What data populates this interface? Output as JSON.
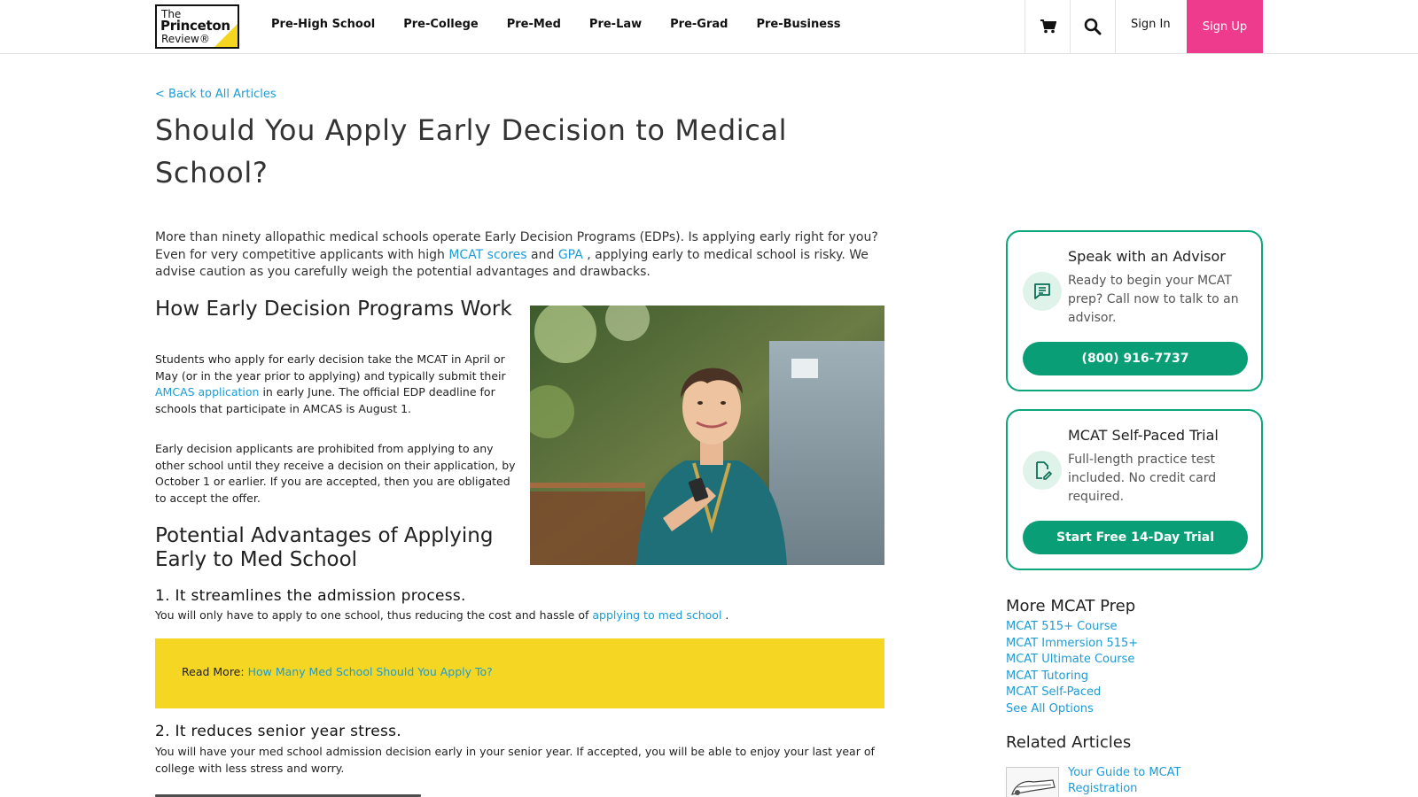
{
  "header": {
    "logo": {
      "line1": "The",
      "line2": "Princeton",
      "line3": "Review®"
    },
    "nav": [
      "Pre-High School",
      "Pre-College",
      "Pre-Med",
      "Pre-Law",
      "Pre-Grad",
      "Pre-Business"
    ],
    "cart_icon": "shopping-cart-icon",
    "search_icon": "search-icon",
    "sign_in": "Sign In",
    "sign_up": "Sign Up"
  },
  "article": {
    "back_link": "< Back to All Articles",
    "title": "Should You Apply Early Decision to Medical School?",
    "intro": {
      "t1": "More than ninety allopathic medical schools operate Early Decision Programs (EDPs). Is applying early right for you? Even for very competitive applicants with high ",
      "link1": "MCAT scores",
      "t2": " and ",
      "link2": "GPA",
      "t3": " , applying early to medical school is risky. We advise caution as you carefully weigh the potential advantages and drawbacks."
    },
    "section1_heading": "How Early Decision Programs Work",
    "p1": {
      "t1": "Students who apply for early decision take the MCAT in April or May (or in the year prior to applying) and typically submit their ",
      "link": "AMCAS application",
      "t2": " in early June. The official EDP deadline for schools that participate  in AMCAS is August 1."
    },
    "p2": "Early decision applicants are prohibited from applying to any other school until they receive a decision on their application, by October 1 or earlier. If you are accepted, then you are obligated to accept the offer.",
    "section2_heading": "Potential Advantages of Applying Early to Med School",
    "point1_heading": "1. It streamlines the admission process.",
    "p3": {
      "t1": "You will only have to apply to one school, thus reducing the cost and hassle of ",
      "link": "applying to med school",
      "t2": " ."
    },
    "read_more": {
      "label": "Read More:",
      "link": "How Many Med School Should You Apply To?"
    },
    "point2_heading": "2. It reduces senior year stress.",
    "p4": "You will have your med school admission decision early in your senior year. If accepted, you will be able to enjoy your last year of college with less stress and worry."
  },
  "sidebar": {
    "advisor_card": {
      "icon": "chat-message-icon",
      "title": "Speak with an Advisor",
      "text": "Ready to begin your MCAT prep? Call now to talk to an advisor.",
      "button": "(800) 916-7737"
    },
    "trial_card": {
      "icon": "document-edit-icon",
      "title": "MCAT Self-Paced Trial",
      "text": "Full-length practice test included. No credit card required.",
      "button": "Start Free 14-Day Trial"
    },
    "more_heading": "More MCAT Prep",
    "more_links": [
      "MCAT 515+ Course",
      "MCAT Immersion 515+",
      "MCAT Ultimate Course",
      "MCAT Tutoring",
      "MCAT Self-Paced",
      "See All Options"
    ],
    "related_heading": "Related Articles",
    "related_links": [
      "Your Guide to MCAT Registration"
    ]
  },
  "colors": {
    "accent_green": "#0a9e76",
    "link_blue": "#1c9bd6",
    "signup_pink": "#ee3b8d",
    "readmore_yellow": "#f4d623"
  }
}
